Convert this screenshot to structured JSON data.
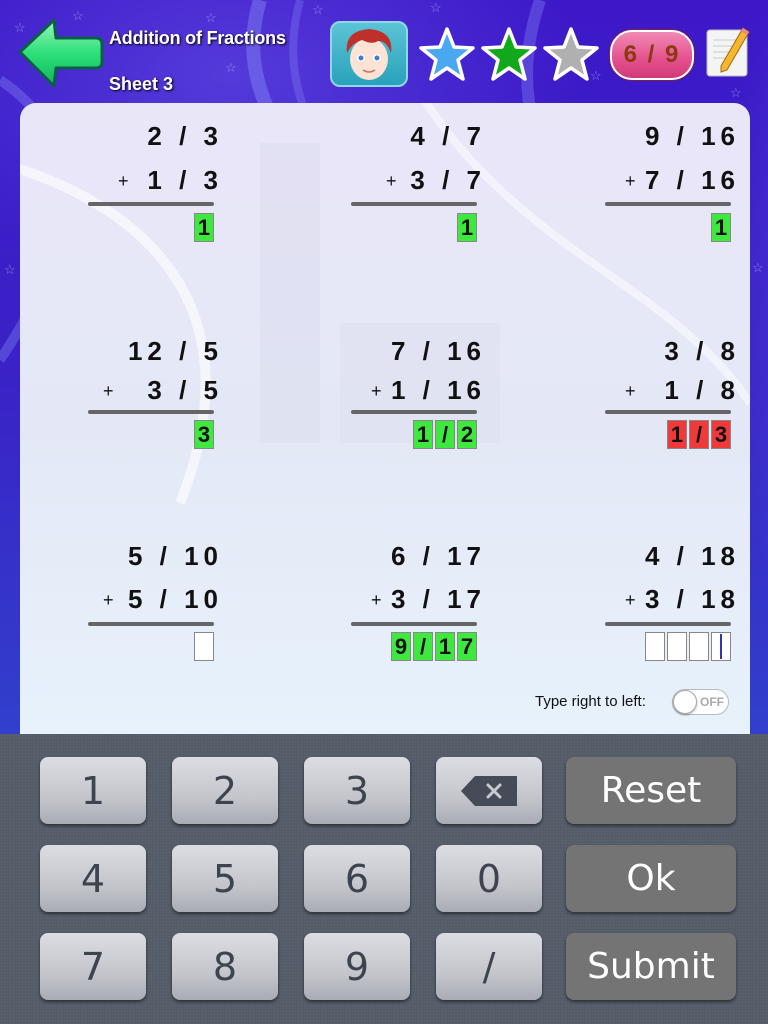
{
  "header": {
    "title": "Addition of Fractions",
    "subtitle": "Sheet 3",
    "back_icon": "back-arrow-icon",
    "avatar_icon": "boy-avatar-icon",
    "stars": [
      {
        "icon": "star-icon",
        "color": "#4aa8f0",
        "state": "earned-blue"
      },
      {
        "icon": "star-icon",
        "color": "#12a81c",
        "state": "earned-green"
      },
      {
        "icon": "star-icon",
        "color": "#b0b0b0",
        "state": "not-earned"
      }
    ],
    "score": "6 / 9",
    "notes_icon": "notepad-pencil-icon"
  },
  "problems": [
    {
      "top": "2 / 3",
      "bottom": "1 / 3",
      "operator": "+",
      "answer": [
        "1"
      ],
      "status": "correct"
    },
    {
      "top": "4 / 7",
      "bottom": "3 / 7",
      "operator": "+",
      "answer": [
        "1"
      ],
      "status": "correct"
    },
    {
      "top": "9 / 16",
      "bottom": "7 / 16",
      "operator": "+",
      "answer": [
        "1"
      ],
      "status": "correct"
    },
    {
      "top": "12 / 5",
      "bottom": "3 / 5",
      "operator": "+",
      "answer": [
        "3"
      ],
      "status": "correct"
    },
    {
      "top": "7 / 16",
      "bottom": "1 / 16",
      "operator": "+",
      "answer": [
        "1",
        "/",
        "2"
      ],
      "status": "correct"
    },
    {
      "top": "3 / 8",
      "bottom": "1 / 8",
      "operator": "+",
      "answer": [
        "1",
        "/",
        "3"
      ],
      "status": "wrong"
    },
    {
      "top": "5 / 10",
      "bottom": "5 / 10",
      "operator": "+",
      "answer": [
        ""
      ],
      "status": "empty"
    },
    {
      "top": "6 / 17",
      "bottom": "3 / 17",
      "operator": "+",
      "answer": [
        "9",
        "/",
        "1",
        "7"
      ],
      "status": "correct"
    },
    {
      "top": "4 / 18",
      "bottom": "3 / 18",
      "operator": "+",
      "answer": [
        "",
        "",
        "",
        ""
      ],
      "status": "active"
    }
  ],
  "colors": {
    "correct": "#3ee83e",
    "wrong": "#f03a3a",
    "background": "#3a1fc0"
  },
  "options": {
    "rtl_label": "Type right to left:",
    "rtl_toggle": "OFF"
  },
  "keypad": {
    "keys": [
      "1",
      "2",
      "3",
      "4",
      "5",
      "6",
      "7",
      "8",
      "9",
      "0",
      "/"
    ],
    "backspace_icon": "backspace-icon",
    "reset": "Reset",
    "ok": "Ok",
    "submit": "Submit"
  }
}
